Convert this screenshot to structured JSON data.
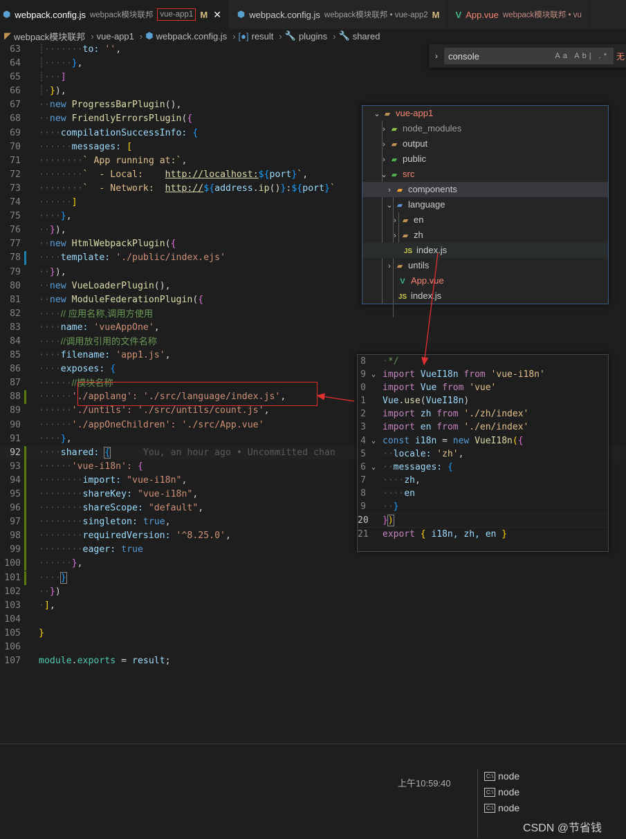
{
  "tabs": [
    {
      "name": "webpack.config.js",
      "desc": "webpack模块联邦",
      "desc2": "vue-app1",
      "mark": "M",
      "close": "✕"
    },
    {
      "name": "webpack.config.js",
      "desc": "webpack模块联邦 • vue-app2",
      "mark": "M"
    },
    {
      "name": "App.vue",
      "desc": "webpack模块联邦 • vu"
    }
  ],
  "breadcrumb": [
    "webpack模块联邦",
    "vue-app1",
    "webpack.config.js",
    "result",
    "plugins",
    "shared"
  ],
  "find": {
    "value": "console",
    "options": "Aa Ab| .*",
    "result": "无"
  },
  "explorer": {
    "root": "vue-app1",
    "items": [
      "node_modules",
      "output",
      "public",
      "src",
      "components",
      "language",
      "en",
      "zh",
      "index.js",
      "untils",
      "App.vue",
      "index.js"
    ]
  },
  "blame": "You, an hour ago • Uncommitted chan",
  "clock": "上午10:59:40",
  "terminals": [
    "node",
    "node",
    "node"
  ],
  "watermark": "CSDN @节省钱",
  "line_numbers": [
    "63",
    "64",
    "65",
    "66",
    "67",
    "68",
    "69",
    "70",
    "71",
    "72",
    "73",
    "74",
    "75",
    "76",
    "77",
    "78",
    "79",
    "80",
    "81",
    "82",
    "83",
    "84",
    "85",
    "86",
    "87",
    "88",
    "89",
    "90",
    "91",
    "92",
    "93",
    "94",
    "95",
    "96",
    "97",
    "98",
    "99",
    "100",
    "101",
    "102",
    "103",
    "104",
    "105",
    "106",
    "107"
  ],
  "snippet_line_numbers": [
    "8",
    "9",
    "0",
    "1",
    "2",
    "3",
    "4",
    "5",
    "6",
    "7",
    "8",
    "9",
    "20",
    "21"
  ],
  "code": {
    "to": "to:",
    "to_val": "''",
    "to_comma": ",",
    "plugin_progress": "ProgressBarPlugin",
    "plugin_friendly": "FriendlyErrorsPlugin",
    "compilation": "compilationSuccessInfo:",
    "messages": "messages:",
    "msg1": "App running at:",
    "msg2_label": "- Local:",
    "msg2_url": "http://localhost:",
    "msg2_var": "port",
    "msg3_label": "- Network:",
    "msg3_url": "http://",
    "msg3_obj": "address",
    "msg3_fn": "ip",
    "msg3_var": "port",
    "plugin_html": "HtmlWebpackPlugin",
    "template": "template:",
    "template_val": "'./public/index.ejs'",
    "plugin_vue": "VueLoaderPlugin",
    "plugin_mf": "ModuleFederationPlugin",
    "cm1": "// 应用名称,调用方使用",
    "name": "name:",
    "name_val": "'vueAppOne'",
    "cm2": "//调用放引用的文件名称",
    "filename": "filename:",
    "filename_val": "'app1.js'",
    "exposes": "exposes:",
    "cm3": "//模块名称",
    "exp1_key": "'./applang':",
    "exp1_val": "'./src/language/index.js'",
    "exp2_key": "'./untils':",
    "exp2_val": "'./src/untils/count.js'",
    "exp3_key": "'./appOneChildren':",
    "exp3_val": "'./src/App.vue'",
    "shared": "shared:",
    "vi18n": "'vue-i18n':",
    "import": "import:",
    "import_val": "\"vue-i18n\"",
    "shareKey": "shareKey:",
    "shareKey_val": "\"vue-i18n\"",
    "shareScope": "shareScope:",
    "shareScope_val": "\"default\"",
    "singleton": "singleton:",
    "true": "true",
    "requiredVersion": "requiredVersion:",
    "rv_val": "'^8.25.0'",
    "eager": "eager:",
    "module": "module",
    "exports": "exports",
    "result": "result"
  },
  "snippet": {
    "l1": "*/",
    "import": "import",
    "from": "from",
    "VueI18n": "VueI18n",
    "vue_i18n": "'vue-i18n'",
    "Vue": "Vue",
    "vue": "'vue'",
    "use": "use",
    "zh": "zh",
    "zh_path": "'./zh/index'",
    "en": "en",
    "en_path": "'./en/index'",
    "const": "const",
    "i18n": "i18n",
    "new": "new",
    "locale": "locale:",
    "locale_val": "'zh'",
    "messages": "messages:",
    "export": "export",
    "export_list": "i18n, zh, en"
  }
}
